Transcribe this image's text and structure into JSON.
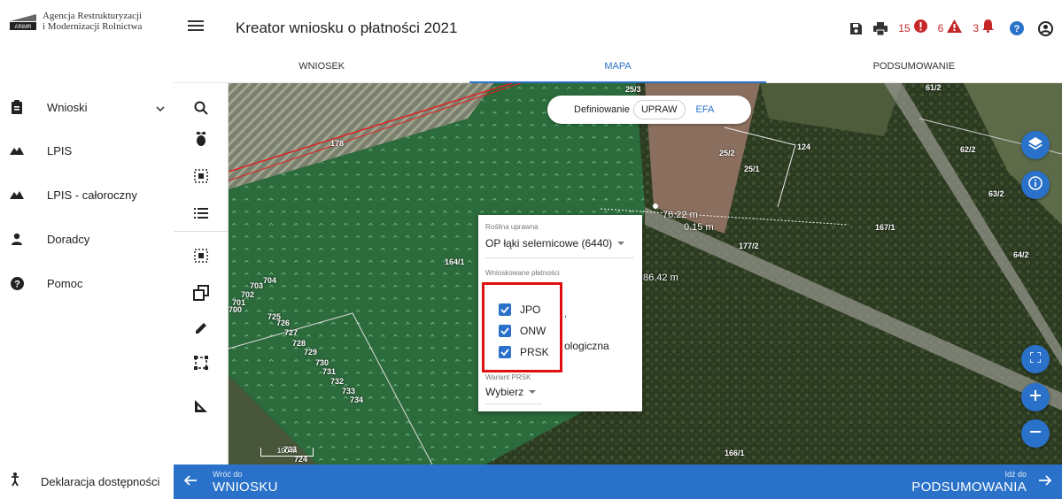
{
  "brand": {
    "logo_text": "ARiMR",
    "agency_line1": "Agencja Restrukturyzacji",
    "agency_line2": "i Modernizacji Rolnictwa"
  },
  "nav": {
    "items": [
      {
        "label": "Wnioski",
        "icon": "clipboard-icon",
        "has_chevron": true
      },
      {
        "label": "LPIS",
        "icon": "terrain-icon"
      },
      {
        "label": "LPIS - całoroczny",
        "icon": "terrain-icon"
      },
      {
        "label": "Doradcy",
        "icon": "person-icon"
      },
      {
        "label": "Pomoc",
        "icon": "help-circle-icon"
      }
    ],
    "accessibility_label": "Deklaracja dostępności"
  },
  "header": {
    "title": "Kreator wniosku o płatności 2021",
    "errors_count": "15",
    "warnings_count": "6",
    "notifications_count": "3",
    "colors": {
      "error": "#c62828",
      "accent": "#2a72c9"
    }
  },
  "tabs": [
    {
      "label": "WNIOSEK",
      "active": false
    },
    {
      "label": "MAPA",
      "active": true
    },
    {
      "label": "PODSUMOWANIE",
      "active": false
    }
  ],
  "map": {
    "toggle": {
      "label": "Definiowanie",
      "options": [
        "UPRAW",
        "EFA"
      ],
      "selected": "UPRAW"
    },
    "parcels": [
      "25/3",
      "61/2",
      "178",
      "25/2",
      "25/1",
      "124",
      "62/2",
      "63/2",
      "167/1",
      "177/2",
      "64/2",
      "164/1",
      "703",
      "704",
      "702",
      "701",
      "700",
      "725",
      "726",
      "727",
      "728",
      "729",
      "730",
      "731",
      "732",
      "733",
      "734",
      "166/1",
      "723",
      "724"
    ],
    "measurements": [
      "76.22 m",
      "0.15 m",
      "86.42 m"
    ],
    "scale": "100 m"
  },
  "popup": {
    "crop_label": "Roślina uprawna",
    "crop_value": "OP łąki selernicowe (6440)",
    "payments_label": "Wnioskowane płatności",
    "payments": [
      {
        "label": "JPO",
        "checked": true
      },
      {
        "label": "ONW",
        "checked": true
      },
      {
        "label": "PRSK",
        "checked": true
      }
    ],
    "obscured_fragment": "ologiczna",
    "variant_label": "Wariant PRSK",
    "variant_value": "Wybierz"
  },
  "bottom": {
    "back_small": "Wróć do",
    "back_big": "WNIOSKU",
    "next_small": "Idź do",
    "next_big": "PODSUMOWANIA"
  }
}
